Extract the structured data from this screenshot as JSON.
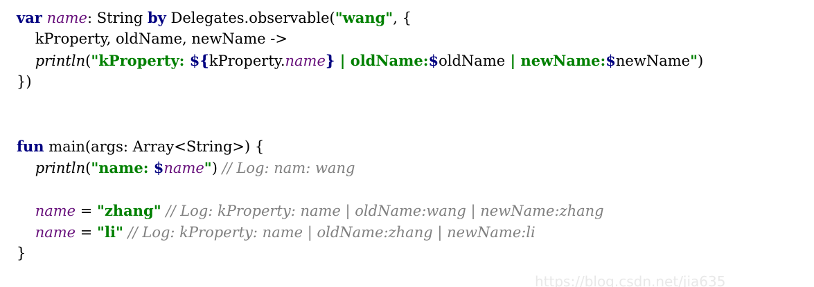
{
  "code": {
    "l1": {
      "var_kw": "var",
      "name": "name",
      "colon_type": ": String ",
      "by_kw": "by",
      "delegates_call": " Delegates.observable(",
      "wang_str": "\"wang\"",
      "tail": ", {"
    },
    "l2": {
      "text": "    kProperty, oldName, newName ->"
    },
    "l3": {
      "indent": "    ",
      "println": "println",
      "paren_open": "(",
      "str_open": "\"kProperty: ",
      "tmpl_open": "${",
      "kprop": "kProperty.",
      "name": "name",
      "tmpl_close": "}",
      "sep1": " | ",
      "old_label": "oldName:",
      "dollar1": "$",
      "old_var": "oldName",
      "sep2": " | ",
      "new_label": "newName:",
      "dollar2": "$",
      "new_var": "newName",
      "str_close": "\"",
      "paren_close": ")"
    },
    "l4": {
      "text": "})"
    },
    "l5": {
      "fun_kw": "fun",
      "signature": " main(args: Array<String>) {"
    },
    "l6": {
      "indent": "    ",
      "println": "println",
      "paren_open": "(",
      "str_open": "\"name: ",
      "dollar": "$",
      "name": "name",
      "str_close": "\"",
      "paren_close": ")",
      "comment": " // Log: nam: wang"
    },
    "l7": {
      "indent": "    ",
      "name": "name",
      "assign": " = ",
      "zhang_str": "\"zhang\"",
      "comment": " // Log: kProperty: name | oldName:wang | newName:zhang"
    },
    "l8": {
      "indent": "    ",
      "name": "name",
      "assign": " = ",
      "li_str": "\"li\"",
      "comment": " // Log: kProperty: name | oldName:zhang | newName:li"
    },
    "l9": {
      "text": "}"
    }
  },
  "watermark": "https://blog.csdn.net/jia635",
  "colors": {
    "keyword": "#000080",
    "property": "#660e7a",
    "string": "#008000",
    "comment": "#808080"
  }
}
